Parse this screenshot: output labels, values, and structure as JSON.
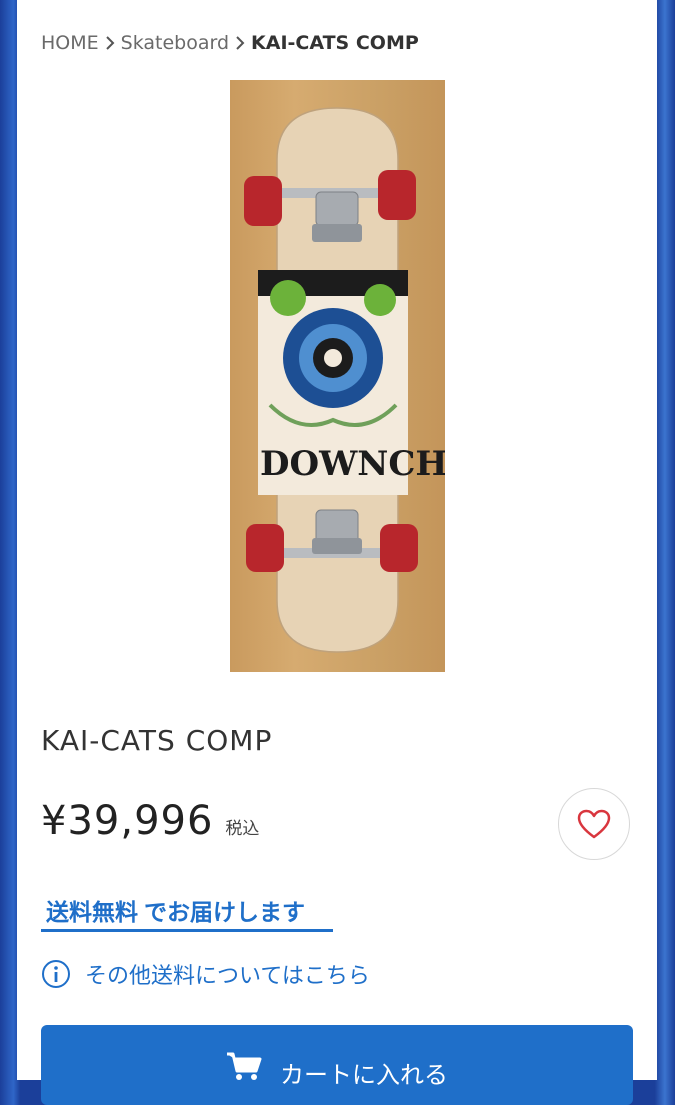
{
  "breadcrumb": {
    "home": "HOME",
    "category": "Skateboard",
    "current": "KAI-CATS COMP"
  },
  "product": {
    "image_text": "DOWNCH",
    "title": "KAI-CATS COMP",
    "price": "¥39,996",
    "tax_label": "税込"
  },
  "shipping": {
    "free_label": "送料無料",
    "suffix": "でお届けします"
  },
  "info_link": "その他送料についてはこちら",
  "cart_button": "カートに入れる",
  "colors": {
    "accent": "#1f6fc9",
    "heart": "#d9363e"
  },
  "icons": {
    "breadcrumb_sep": "chevron-right-icon",
    "favorite": "heart-icon",
    "info": "info-icon",
    "cart": "cart-icon"
  }
}
